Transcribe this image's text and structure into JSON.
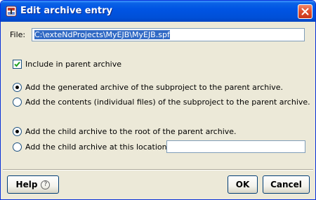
{
  "window": {
    "title": "Edit archive entry"
  },
  "file": {
    "label": "File:",
    "value": "C:\\exteNdProjects\\MyEJB\\MyEJB.spf"
  },
  "include_checkbox": {
    "label": "Include in parent archive",
    "checked": true
  },
  "archive_mode": {
    "options": [
      {
        "label": "Add the generated archive of the subproject to the parent archive.",
        "checked": true
      },
      {
        "label": "Add the contents (individual files) of the subproject to the parent archive.",
        "checked": false
      }
    ]
  },
  "location_mode": {
    "options": [
      {
        "label": "Add the child archive to the root of the parent archive.",
        "checked": true
      },
      {
        "label": "Add the child archive at this location:",
        "checked": false
      }
    ],
    "location_value": ""
  },
  "buttons": {
    "help": "Help",
    "help_icon": "?",
    "ok": "OK",
    "cancel": "Cancel"
  },
  "colors": {
    "titlebar": "#0054e3",
    "dialog_bg": "#ece9d8",
    "selection": "#316ac5",
    "close_button": "#e0502f",
    "radio_checked": "#21a121"
  }
}
